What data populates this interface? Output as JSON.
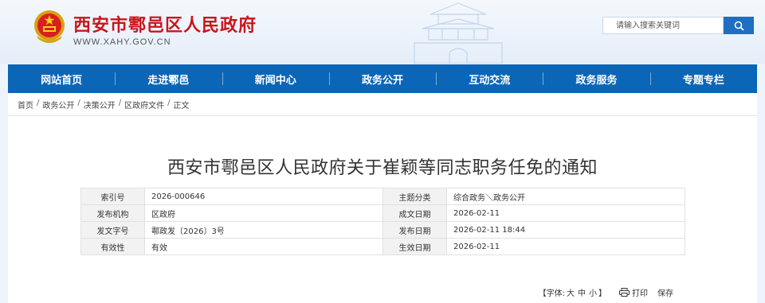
{
  "header": {
    "site_title": "西安市鄠邑区人民政府",
    "site_url": "WWW.XAHY.GOV.CN",
    "search_placeholder": "请输入搜索关键词"
  },
  "nav": [
    "网站首页",
    "走进鄠邑",
    "新闻中心",
    "政务公开",
    "互动交流",
    "政务服务",
    "专题专栏"
  ],
  "breadcrumb": [
    "首页",
    "政务公开",
    "决策公开",
    "区政府文件",
    "正文"
  ],
  "document": {
    "title": "西安市鄠邑区人民政府关于崔颖等同志职务任免的通知",
    "meta": [
      {
        "k1": "索引号",
        "v1": "2026-000646",
        "k2": "主题分类",
        "v2": "综合政务＼政务公开"
      },
      {
        "k1": "发布机构",
        "v1": "区政府",
        "k2": "成文日期",
        "v2": "2026-02-11"
      },
      {
        "k1": "发文字号",
        "v1": "鄠政发〔2026〕3号",
        "k2": "发布日期",
        "v2": "2026-02-11 18:44"
      },
      {
        "k1": "有效性",
        "v1": "有效",
        "k2": "生效日期",
        "v2": "2026-02-11"
      }
    ]
  },
  "tools": {
    "font_label": "【字体:",
    "sizes": [
      "大",
      "中",
      "小"
    ],
    "font_close": "】",
    "print": "打印",
    "save": "保存"
  },
  "colors": {
    "nav_bg": "#0b66b7",
    "title_red": "#c8161d",
    "search_btn": "#1f6fc0"
  },
  "icons": [
    "national-emblem-icon",
    "tower-building-icon",
    "search-icon",
    "print-icon"
  ]
}
